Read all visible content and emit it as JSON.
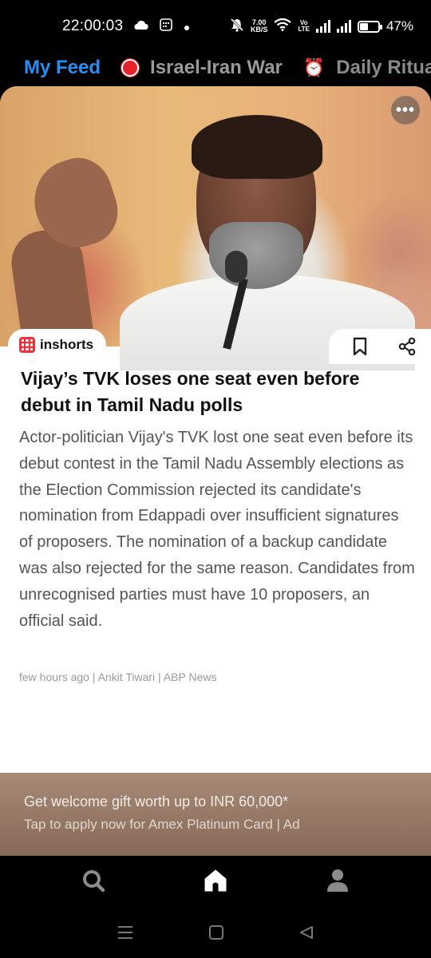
{
  "status_bar": {
    "time": "22:00:03",
    "net_speed_value": "7.00",
    "net_speed_unit": "KB/S",
    "volte_top": "Vo",
    "volte_bottom": "LTE",
    "battery_percent": "47%",
    "battery_level": 0.47
  },
  "tabs": [
    {
      "label": "My Feed"
    },
    {
      "label": "Israel-Iran War"
    },
    {
      "label": "Daily Ritual"
    }
  ],
  "card": {
    "brand_name": "inshorts",
    "headline": "Vijay’s TVK loses one seat even before debut in Tamil Nadu polls",
    "body": "Actor-politician Vijay's TVK lost one seat even before its debut contest in the Tamil Nadu Assembly elections as the Election Commission rejected its candidate's nomination from Edappadi over insufficient signatures of proposers. The nomination of a backup candidate was also rejected for the same reason. Candidates from unrecognised parties must have 10 proposers, an official said.",
    "meta": "few hours ago | Ankit Tiwari | ABP News",
    "more_label": "•••"
  },
  "ad": {
    "line1": "Get welcome gift worth up to INR 60,000*",
    "line2": "Tap to apply now for Amex Platinum Card | Ad"
  },
  "colors": {
    "accent": "#2a8ff5",
    "brand_red": "#e8333c",
    "live_red": "#e8202a"
  },
  "icons": {
    "bottom_nav": [
      "search-icon",
      "home-icon",
      "profile-icon"
    ],
    "system_nav": [
      "recents-icon",
      "home-square-icon",
      "back-icon"
    ]
  }
}
